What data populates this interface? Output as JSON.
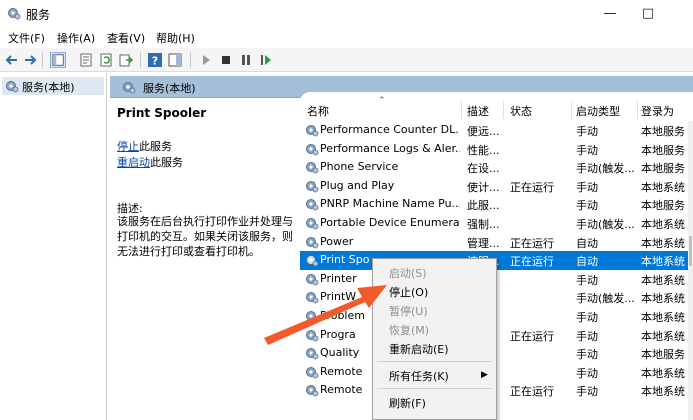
{
  "window": {
    "title": "服务"
  },
  "menubar": {
    "items": [
      "文件(F)",
      "操作(A)",
      "查看(V)",
      "帮助(H)"
    ]
  },
  "tree": {
    "root_label": "服务(本地)"
  },
  "right_header": {
    "label": "服务(本地)"
  },
  "details": {
    "service_name": "Print Spooler",
    "stop_link": "停止",
    "stop_suffix": "此服务",
    "restart_link": "重启动",
    "restart_suffix": "此服务",
    "desc_label": "描述:",
    "desc_text": "该服务在后台执行打印作业并处理与打印机的交互。如果关闭该服务，则无法进行打印或查看打印机。"
  },
  "columns": {
    "name": "名称",
    "desc": "描述",
    "status": "状态",
    "startup": "启动类型",
    "logon": "登录为"
  },
  "rows": [
    {
      "name": "Performance Counter DL...",
      "desc": "便远...",
      "status": "",
      "startup": "手动",
      "logon": "本地服务"
    },
    {
      "name": "Performance Logs & Aler...",
      "desc": "性能...",
      "status": "",
      "startup": "手动",
      "logon": "本地服务"
    },
    {
      "name": "Phone Service",
      "desc": "在设...",
      "status": "",
      "startup": "手动(触发...",
      "logon": "本地服务"
    },
    {
      "name": "Plug and Play",
      "desc": "使计...",
      "status": "正在运行",
      "startup": "手动",
      "logon": "本地系统"
    },
    {
      "name": "PNRP Machine Name Pu...",
      "desc": "此服...",
      "status": "",
      "startup": "手动",
      "logon": "本地服务"
    },
    {
      "name": "Portable Device Enumera...",
      "desc": "强制...",
      "status": "",
      "startup": "手动(触发...",
      "logon": "本地系统"
    },
    {
      "name": "Power",
      "desc": "管理...",
      "status": "正在运行",
      "startup": "自动",
      "logon": "本地系统"
    },
    {
      "name": "Print Spo",
      "desc": "该服...",
      "status": "正在运行",
      "startup": "自动",
      "logon": "本地系统"
    },
    {
      "name": "Printer",
      "desc": "",
      "status": "",
      "startup": "手动",
      "logon": "本地系统"
    },
    {
      "name": "PrintW",
      "desc": "",
      "status": "",
      "startup": "手动(触发...",
      "logon": "本地系统"
    },
    {
      "name": "Problem",
      "desc": "",
      "status": "",
      "startup": "手动",
      "logon": "本地系统"
    },
    {
      "name": "Progra",
      "desc": "",
      "status": "正在运行",
      "startup": "手动",
      "logon": "本地系统"
    },
    {
      "name": "Quality",
      "desc": "",
      "status": "",
      "startup": "手动",
      "logon": "本地服务"
    },
    {
      "name": "Remote",
      "desc": "",
      "status": "",
      "startup": "手动",
      "logon": "本地系统"
    },
    {
      "name": "Remote",
      "desc": "",
      "status": "正在运行",
      "startup": "手动",
      "logon": "本地系统"
    }
  ],
  "context_menu": {
    "start": "启动(S)",
    "stop": "停止(O)",
    "pause": "暂停(U)",
    "resume": "恢复(M)",
    "restart": "重新启动(E)",
    "all_tasks": "所有任务(K)",
    "refresh": "刷新(F)"
  },
  "colors": {
    "accent": "#0078d7",
    "header": "#a6bfd9",
    "arrow": "#f15a2b",
    "link": "#0645ad"
  }
}
